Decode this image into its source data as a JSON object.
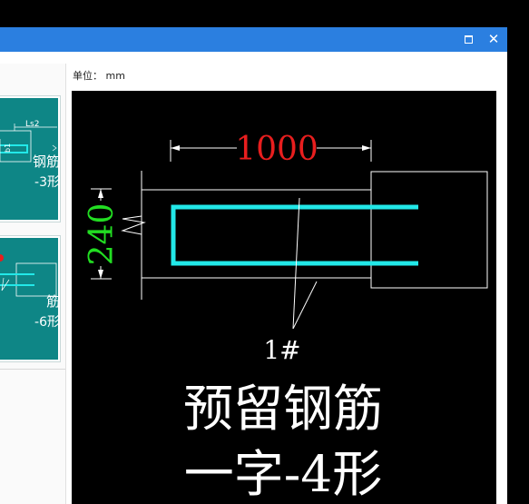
{
  "window": {
    "maximize_icon": "maximize-icon",
    "close_icon": "close-icon",
    "close_glyph": "✕",
    "titlebar_color": "#2b7fe0"
  },
  "unit": {
    "label": "单位：",
    "value": "mm"
  },
  "cards": [
    {
      "name": "钢筋",
      "type": "-3形",
      "dim_label": "Ls2",
      "side_label": "b1"
    },
    {
      "name": "筋",
      "type": "-6形"
    }
  ],
  "preview": {
    "length_dim": "1000",
    "height_dim": "240",
    "bar_mark": "1#",
    "title_line1": "预留钢筋",
    "title_line2": "一字-4形",
    "colors": {
      "length_dim": "#e81e1e",
      "height_dim": "#22dd22",
      "rebar": "#22e8e8",
      "lines": "#ffffff",
      "background": "#0e8686"
    }
  }
}
